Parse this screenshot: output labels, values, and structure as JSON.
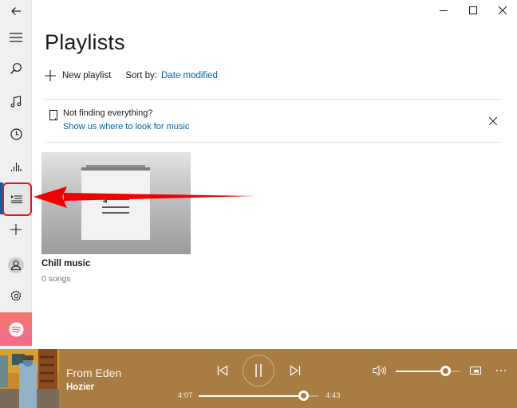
{
  "window": {
    "minimize_icon": "minimize-icon",
    "maximize_icon": "maximize-icon",
    "close_icon": "close-icon"
  },
  "sidebar": {
    "items": [
      {
        "name": "back",
        "icon": "back-arrow-icon"
      },
      {
        "name": "menu",
        "icon": "hamburger-icon"
      },
      {
        "name": "search",
        "icon": "search-icon"
      },
      {
        "name": "my-music",
        "icon": "music-note-icon"
      },
      {
        "name": "recent-plays",
        "icon": "clock-icon"
      },
      {
        "name": "now-playing",
        "icon": "equalizer-icon"
      },
      {
        "name": "playlists",
        "icon": "playlist-icon",
        "active": true
      },
      {
        "name": "new-playlist",
        "icon": "plus-icon"
      },
      {
        "name": "account",
        "icon": "user-icon"
      },
      {
        "name": "settings",
        "icon": "gear-icon"
      },
      {
        "name": "spotify",
        "icon": "spotify-icon"
      }
    ],
    "accent": "#0063b1"
  },
  "main": {
    "title": "Playlists",
    "toolbar": {
      "new_playlist_label": "New playlist",
      "sort_label": "Sort by:",
      "sort_value": "Date modified"
    },
    "notice": {
      "title": "Not finding everything?",
      "link": "Show us where to look for music"
    },
    "playlists": [
      {
        "name": "Chill music",
        "count": "0 songs"
      }
    ]
  },
  "annotation": {
    "color": "#e81123",
    "target": "playlists"
  },
  "player": {
    "song_title": "From Eden",
    "artist": "Hozier",
    "elapsed": "4:07",
    "duration": "4:43",
    "progress_fraction": 0.87,
    "volume_fraction": 0.78,
    "background": "#a87d44"
  }
}
